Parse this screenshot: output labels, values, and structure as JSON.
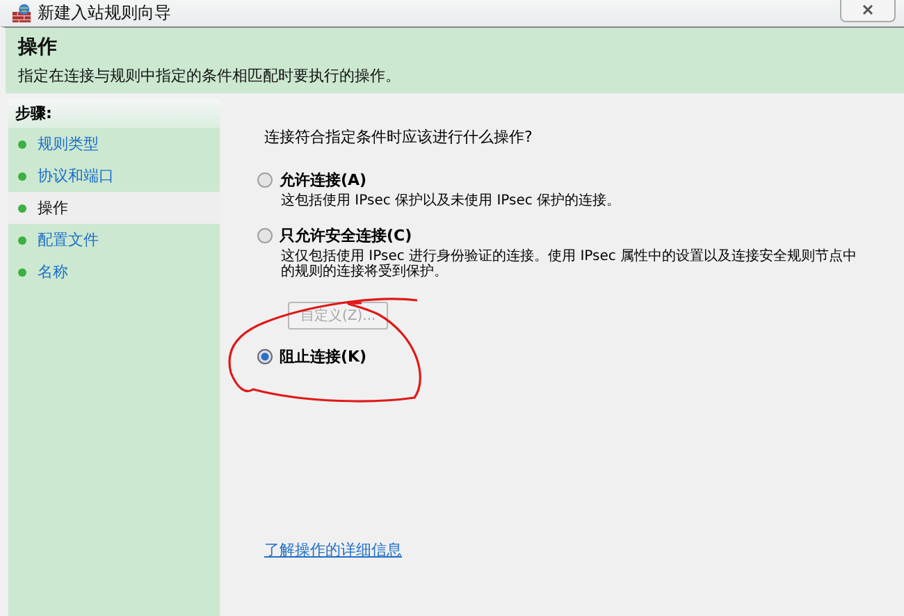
{
  "window": {
    "title": "新建入站规则向导"
  },
  "header": {
    "title": "操作",
    "description": "指定在连接与规则中指定的条件相匹配时要执行的操作。"
  },
  "sidebar": {
    "title": "步骤:",
    "items": [
      {
        "label": "规则类型",
        "selected": false
      },
      {
        "label": "协议和端口",
        "selected": false
      },
      {
        "label": "操作",
        "selected": true
      },
      {
        "label": "配置文件",
        "selected": false
      },
      {
        "label": "名称",
        "selected": false
      }
    ]
  },
  "content": {
    "question": "连接符合指定条件时应该进行什么操作?",
    "options": [
      {
        "label": "允许连接(A)",
        "description": "这包括使用 IPsec 保护以及未使用 IPsec 保护的连接。",
        "selected": false
      },
      {
        "label": "只允许安全连接(C)",
        "description": "这仅包括使用 IPsec 进行身份验证的连接。使用 IPsec 属性中的设置以及连接安全规则节点中的规则的连接将受到保护。",
        "selected": false,
        "button": {
          "label": "自定义(Z)...",
          "disabled": true
        }
      },
      {
        "label": "阻止连接(K)",
        "selected": true
      }
    ],
    "link": "了解操作的详细信息"
  }
}
